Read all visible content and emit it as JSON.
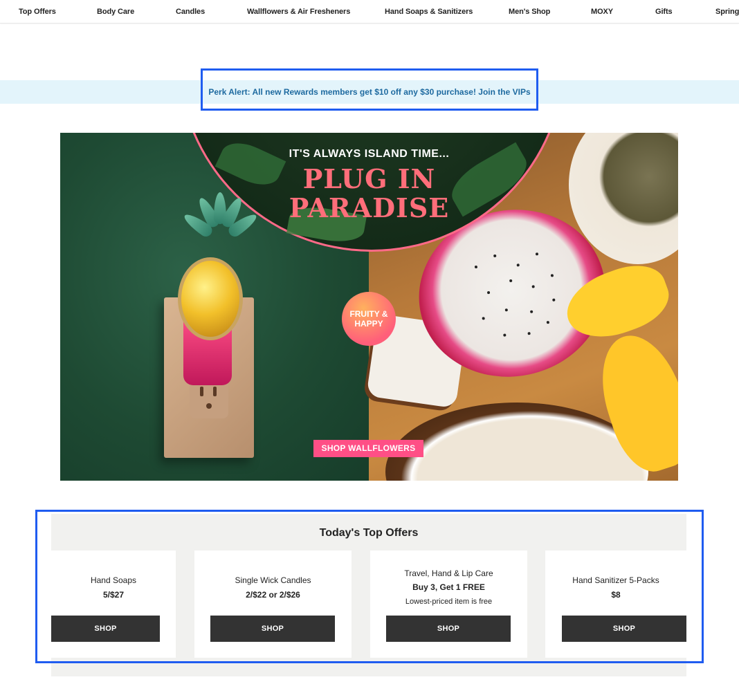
{
  "nav": {
    "items": [
      {
        "label": "Top Offers"
      },
      {
        "label": "Body Care"
      },
      {
        "label": "Candles"
      },
      {
        "label": "Wallflowers & Air Fresheners"
      },
      {
        "label": "Hand Soaps & Sanitizers"
      },
      {
        "label": "Men's Shop"
      },
      {
        "label": "MOXY"
      },
      {
        "label": "Gifts"
      },
      {
        "label": "Spring S"
      }
    ]
  },
  "perk": {
    "text": "Perk Alert: All new Rewards members get $10 off any $30 purchase! Join the VIPs"
  },
  "hero": {
    "eyebrow": "IT'S ALWAYS ISLAND TIME...",
    "headline_line1": "PLUG IN",
    "headline_line2": "PARADISE",
    "badge_line1": "FRUITY &",
    "badge_line2": "HAPPY",
    "cta": "SHOP WALLFLOWERS"
  },
  "offers": {
    "title": "Today's Top Offers",
    "cards": [
      {
        "label": "Hand Soaps",
        "price": "5/$27",
        "note": "",
        "button": "SHOP"
      },
      {
        "label": "Single Wick Candles",
        "price": "2/$22 or 2/$26",
        "note": "",
        "button": "SHOP"
      },
      {
        "label": "Travel, Hand & Lip Care",
        "price": "Buy 3, Get 1 FREE",
        "note": "Lowest-priced item is free",
        "button": "SHOP"
      },
      {
        "label": "Hand Sanitizer 5-Packs",
        "price": "$8",
        "note": "",
        "button": "SHOP"
      }
    ]
  },
  "colors": {
    "perk_bg": "#e3f4fb",
    "perk_text": "#1e6aa0",
    "accent_pink": "#ff4f86",
    "button_dark": "#333333",
    "highlight_blue": "#1f5cf0"
  }
}
